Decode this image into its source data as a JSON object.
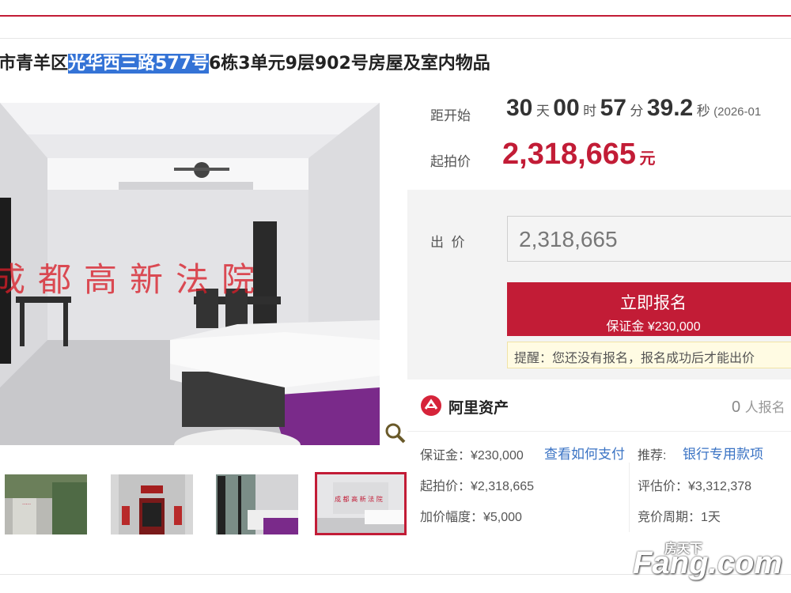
{
  "title": {
    "prefix": "市青羊区",
    "highlight": "光华西三路577号",
    "suffix": "6栋3单元9层902号房屋及室内物品"
  },
  "photo": {
    "watermark_text": "成都高新法院"
  },
  "countdown": {
    "label": "距开始",
    "days": "30",
    "days_unit": "天",
    "hours": "00",
    "hours_unit": "时",
    "minutes": "57",
    "minutes_unit": "分",
    "seconds": "39.2",
    "seconds_unit": "秒",
    "date": "(2026-01"
  },
  "start_price": {
    "label": "起拍价",
    "value": "2,318,665",
    "unit": "元"
  },
  "bid": {
    "label": "出  价",
    "input_value": "2,318,665"
  },
  "register_button": {
    "label": "立即报名",
    "sub": "保证金 ¥230,000"
  },
  "reminder": "提醒：您还没有报名，报名成功后才能出价",
  "provider": {
    "name": "阿里资产",
    "count": "0",
    "count_suffix": "人报名"
  },
  "details": {
    "deposit": "保证金：¥230,000",
    "how_to_pay": "查看如何支付",
    "recommend_label": "推荐:",
    "bank_account": "银行专用款项",
    "start_price": "起拍价：¥2,318,665",
    "appraisal": "评估价：¥3,312,378",
    "increment": "加价幅度：¥5,000",
    "cycle": "竞价周期：1天"
  },
  "site_watermark": {
    "cn": "房天下",
    "en": "Fang.com"
  },
  "colors": {
    "accent": "#c21c36",
    "link": "#3a73c4",
    "highlight": "#3473d6"
  }
}
